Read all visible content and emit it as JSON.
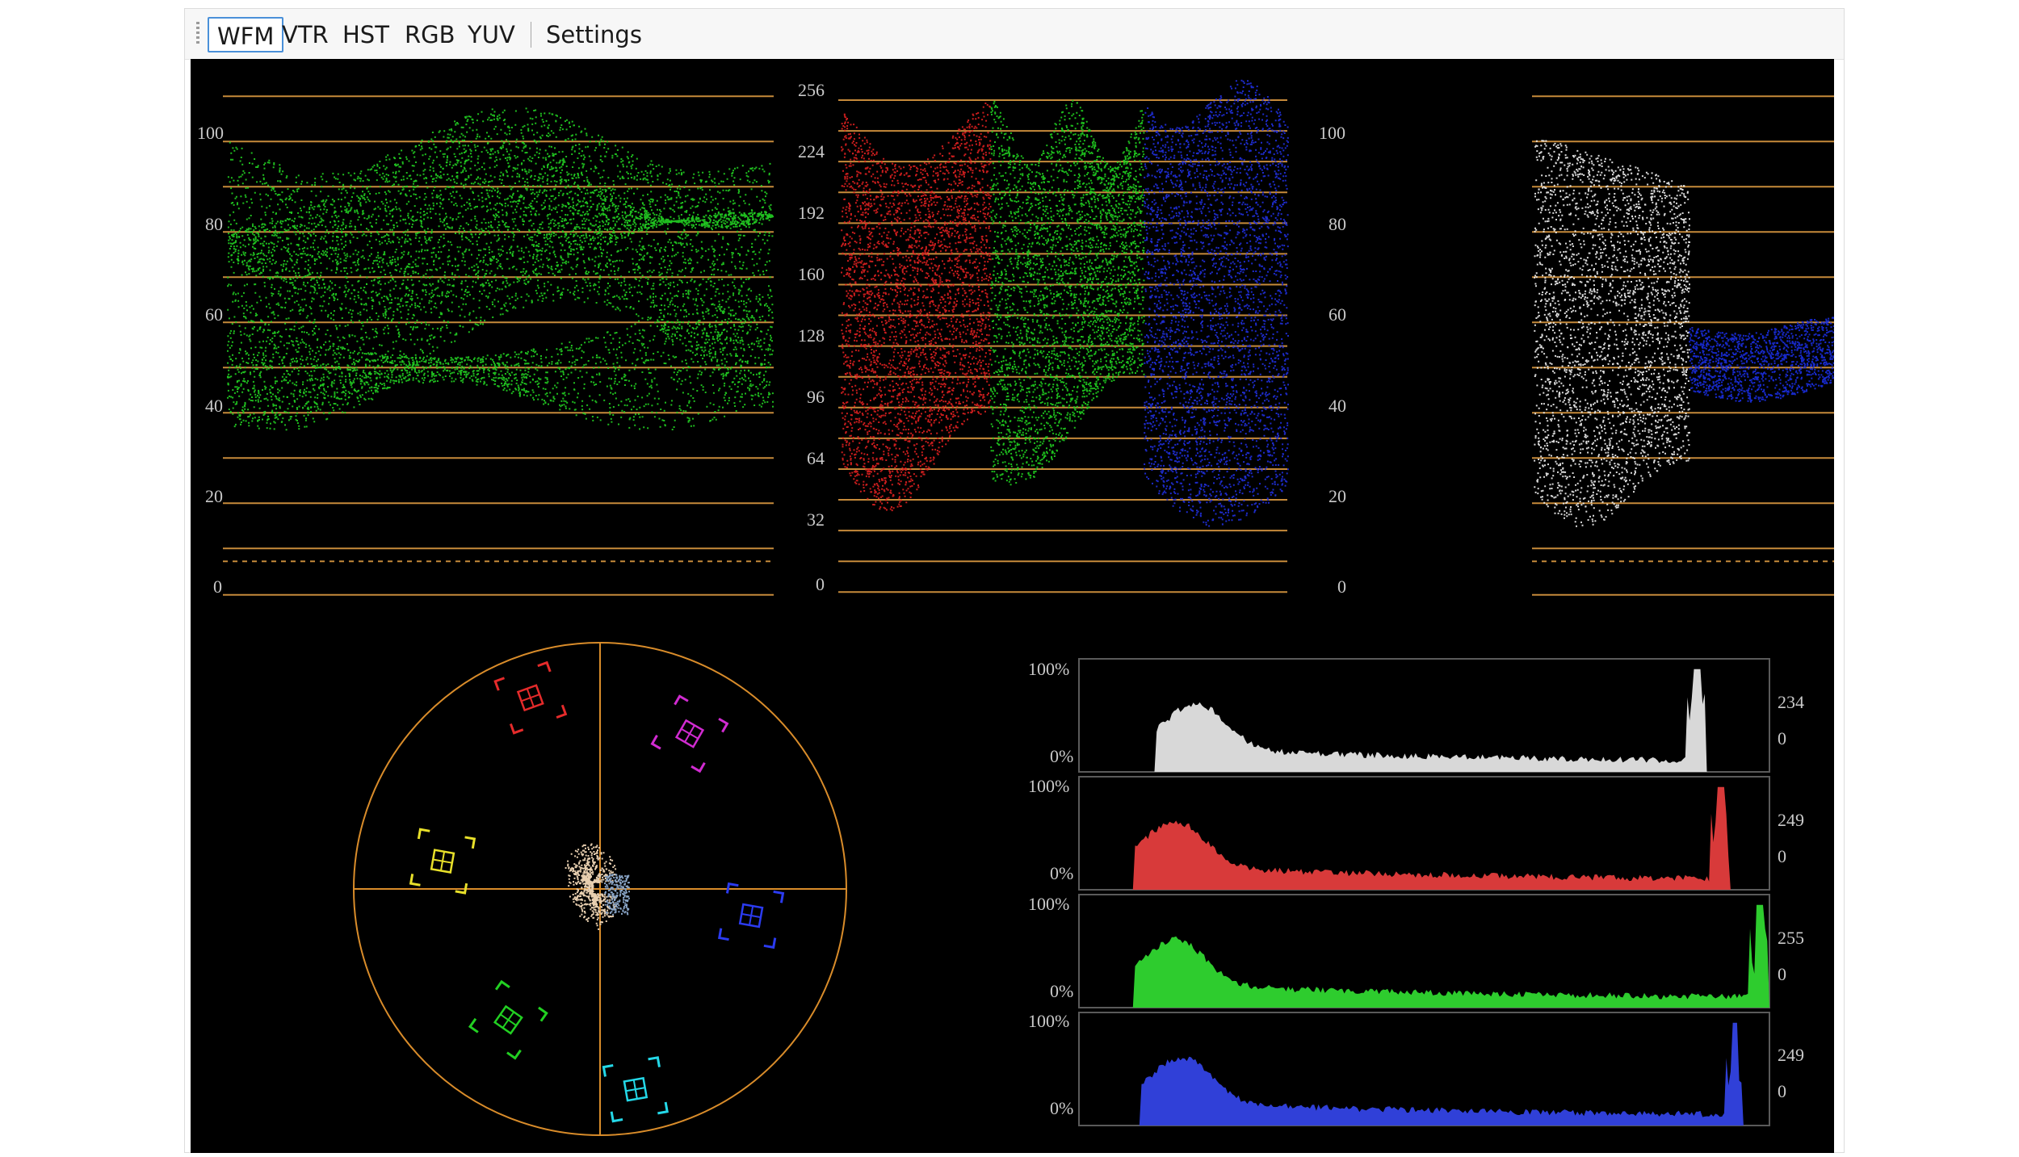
{
  "toolbar": {
    "tabs": [
      {
        "label": "WFM",
        "active": true
      },
      {
        "label": "VTR",
        "active": false
      },
      {
        "label": "HST",
        "active": false
      },
      {
        "label": "RGB",
        "active": false
      },
      {
        "label": "YUV",
        "active": false
      }
    ],
    "settings_label": "Settings"
  },
  "waveform_luma": {
    "scale_labels": [
      "100",
      "80",
      "60",
      "40",
      "20",
      "0"
    ],
    "trace_color": "#22d022"
  },
  "rgb_parade": {
    "scale_labels": [
      "256",
      "224",
      "192",
      "160",
      "128",
      "96",
      "64",
      "32",
      "0"
    ],
    "channel_colors": [
      "#e02020",
      "#20d020",
      "#2030e0"
    ]
  },
  "ycbcr_parade": {
    "scale_labels": [
      "100",
      "80",
      "60",
      "40",
      "20",
      "0"
    ],
    "channel_colors": [
      "#f2f2f2",
      "#1a2ee0",
      "#e01a1a"
    ]
  },
  "vectorscope": {
    "targets": [
      {
        "name": "red",
        "color": "#e52b2b"
      },
      {
        "name": "magenta",
        "color": "#d12bd1"
      },
      {
        "name": "blue",
        "color": "#2b3bf0"
      },
      {
        "name": "cyan",
        "color": "#24d8e8"
      },
      {
        "name": "green",
        "color": "#22d022"
      },
      {
        "name": "yellow",
        "color": "#e8e02a"
      }
    ],
    "graticule_color": "#d98c2a"
  },
  "histograms": [
    {
      "channel": "luma",
      "top_label": "100%",
      "bottom_label": "0%",
      "peak_value": "234",
      "min_value": "0",
      "color": "#d8d8d8"
    },
    {
      "channel": "red",
      "top_label": "100%",
      "bottom_label": "0%",
      "peak_value": "249",
      "min_value": "0",
      "color": "#d83a3a"
    },
    {
      "channel": "green",
      "top_label": "100%",
      "bottom_label": "0%",
      "peak_value": "255",
      "min_value": "0",
      "color": "#2ecc2e"
    },
    {
      "channel": "blue",
      "top_label": "100%",
      "bottom_label": "0%",
      "peak_value": "249",
      "min_value": "0",
      "color": "#3040d8"
    }
  ],
  "colors": {
    "graticule": "#c68a3a",
    "scope_background": "#000000"
  }
}
